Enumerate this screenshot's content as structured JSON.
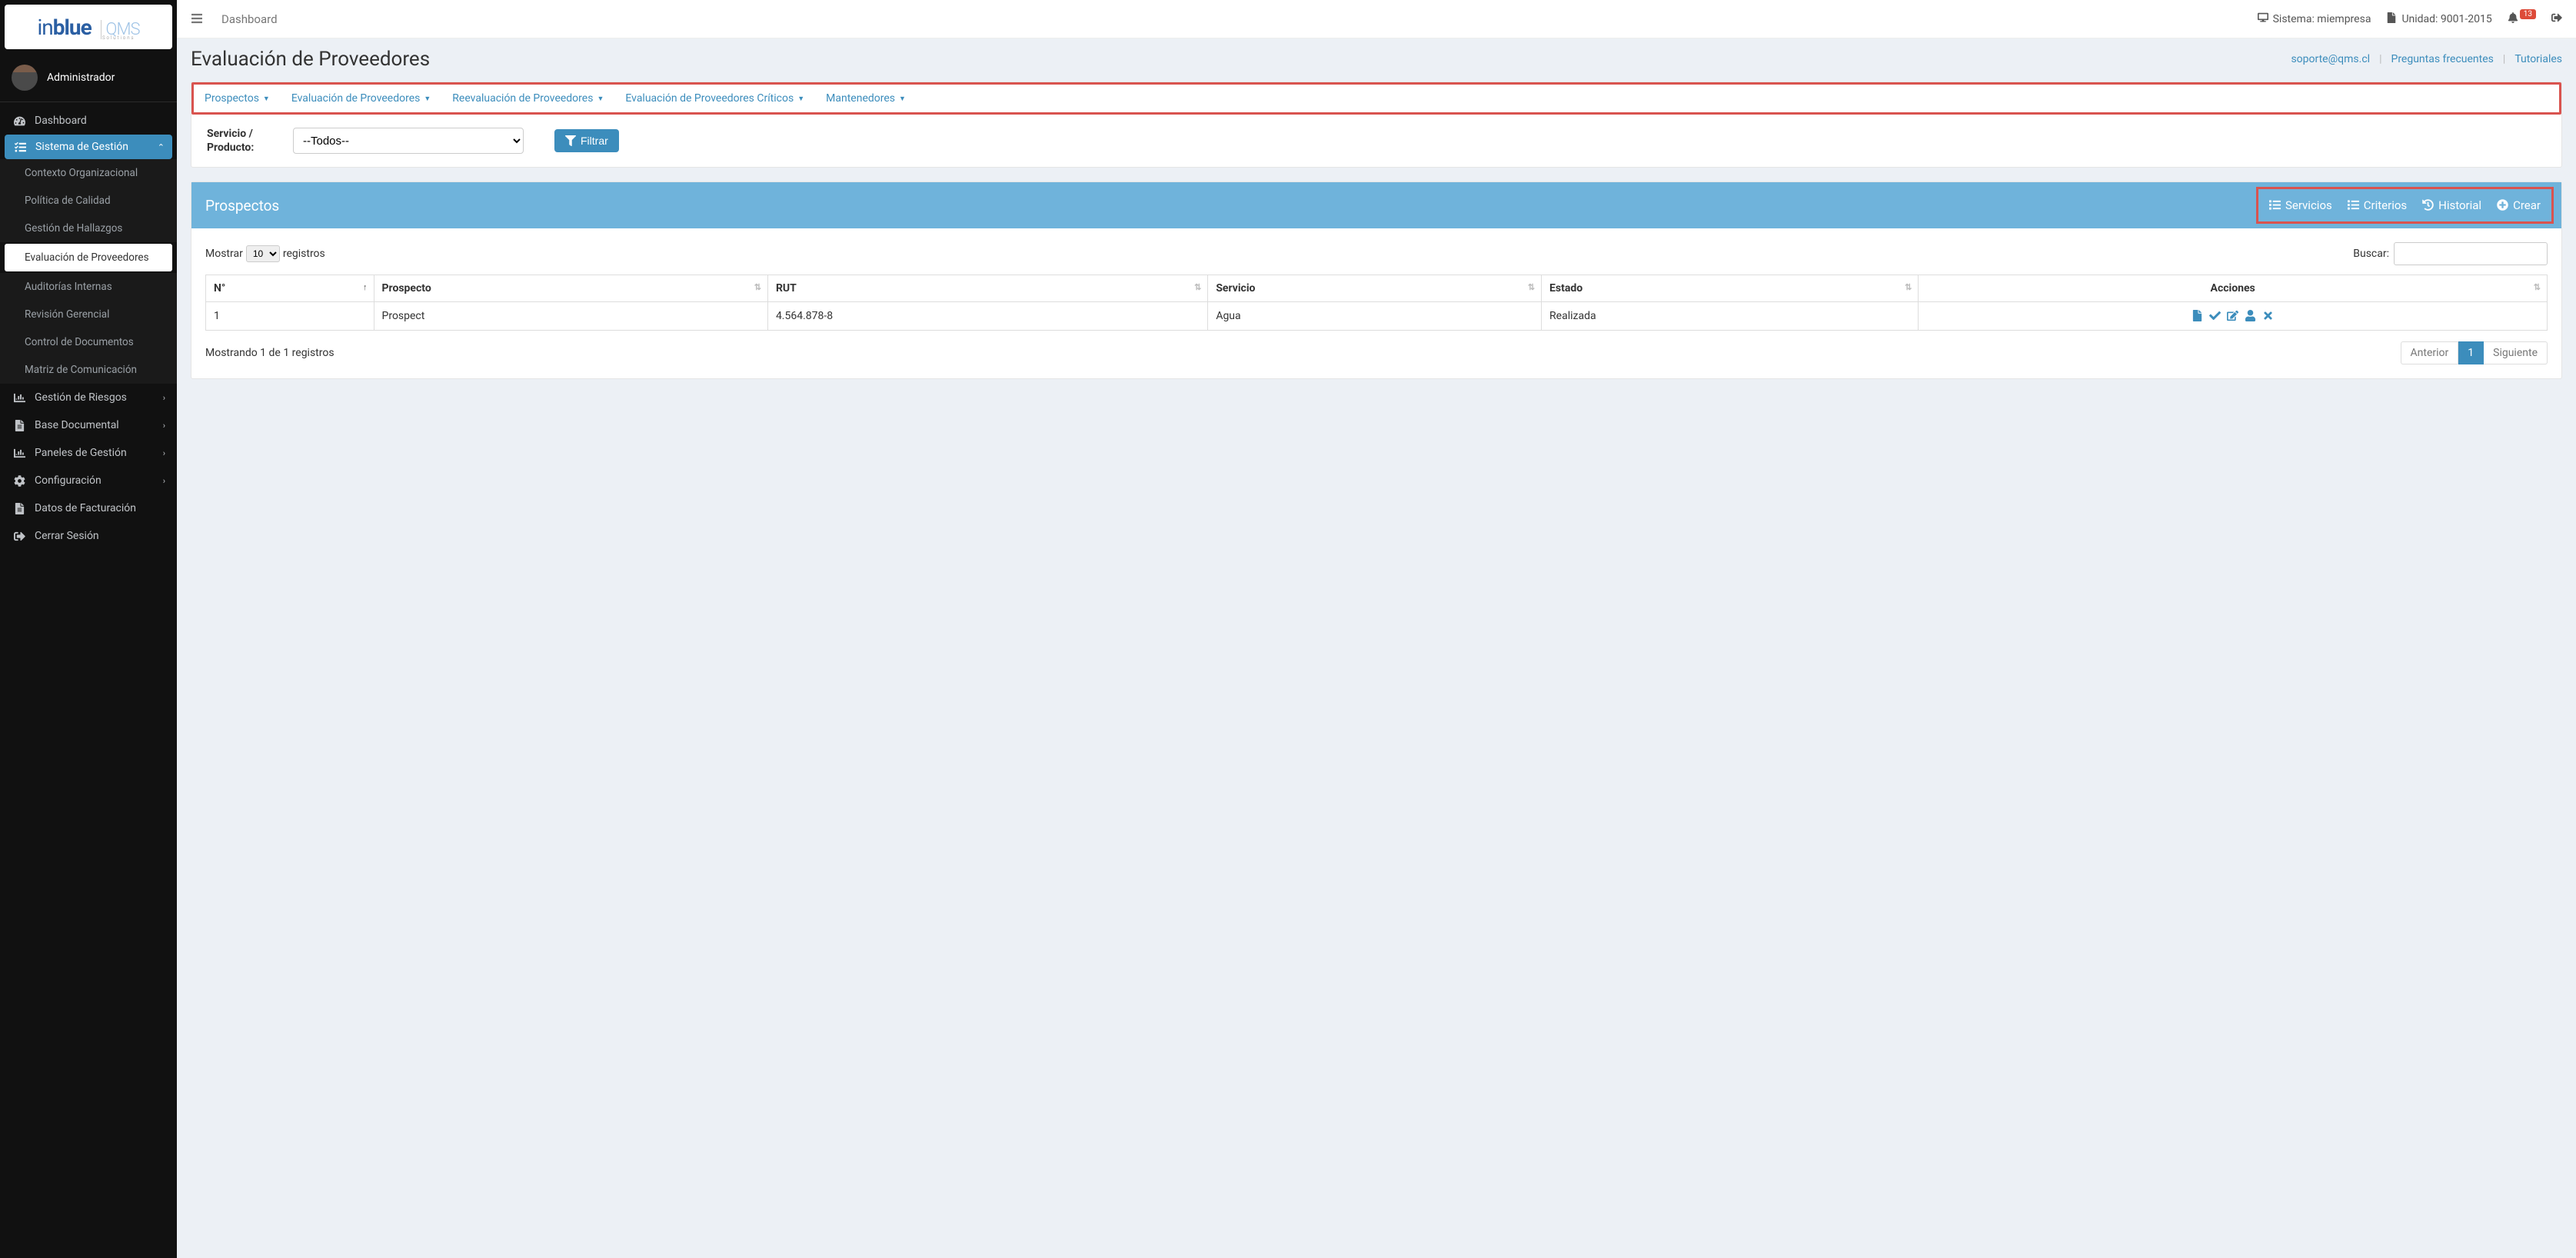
{
  "logo": {
    "brand_in": "in",
    "brand_blue": "blue",
    "brand_qms": "QMS",
    "brand_sub": "Solutions"
  },
  "user": {
    "name": "Administrador"
  },
  "topbar": {
    "breadcrumb": "Dashboard",
    "sistema_label": "Sistema: miempresa",
    "unidad_label": "Unidad: 9001-2015",
    "notif_count": "13"
  },
  "sidebar": {
    "items": [
      {
        "icon": "tachometer",
        "label": "Dashboard"
      },
      {
        "icon": "tasks",
        "label": "Sistema de Gestión",
        "active": true,
        "open": true
      },
      {
        "sub": true,
        "label": "Contexto Organizacional"
      },
      {
        "sub": true,
        "label": "Política de Calidad"
      },
      {
        "sub": true,
        "label": "Gestión de Hallazgos"
      },
      {
        "sub": true,
        "label": "Evaluación de Proveedores",
        "selected": true
      },
      {
        "sub": true,
        "label": "Auditorías Internas"
      },
      {
        "sub": true,
        "label": "Revisión Gerencial"
      },
      {
        "sub": true,
        "label": "Control de Documentos"
      },
      {
        "sub": true,
        "label": "Matriz de Comunicación"
      },
      {
        "icon": "chart-bar",
        "label": "Gestión de Riesgos",
        "caret": true
      },
      {
        "icon": "file",
        "label": "Base Documental",
        "caret": true
      },
      {
        "icon": "chart-bar",
        "label": "Paneles de Gestión",
        "caret": true
      },
      {
        "icon": "gear",
        "label": "Configuración",
        "caret": true
      },
      {
        "icon": "file",
        "label": "Datos de Facturación"
      },
      {
        "icon": "sign-out",
        "label": "Cerrar Sesión"
      }
    ]
  },
  "page": {
    "title": "Evaluación de Proveedores",
    "links": {
      "support": "soporte@qms.cl",
      "faq": "Preguntas frecuentes",
      "tutorials": "Tutoriales"
    }
  },
  "tabs": [
    "Prospectos",
    "Evaluación de Proveedores",
    "Reevaluación de Proveedores",
    "Evaluación de Proveedores Críticos",
    "Mantenedores"
  ],
  "filter": {
    "label": "Servicio / Producto:",
    "selected": "--Todos--",
    "button": "Filtrar"
  },
  "panel": {
    "title": "Prospectos",
    "actions": {
      "servicios": "Servicios",
      "criterios": "Criterios",
      "historial": "Historial",
      "crear": "Crear"
    }
  },
  "table": {
    "show_prefix": "Mostrar",
    "show_suffix": "registros",
    "page_length": "10",
    "search_label": "Buscar:",
    "columns": [
      "N°",
      "Prospecto",
      "RUT",
      "Servicio",
      "Estado",
      "Acciones"
    ],
    "rows": [
      {
        "n": "1",
        "prospecto": "Prospect",
        "rut": "4.564.878-8",
        "servicio": "Agua",
        "estado": "Realizada"
      }
    ],
    "info": "Mostrando 1 de 1 registros",
    "pager": {
      "prev": "Anterior",
      "current": "1",
      "next": "Siguiente"
    }
  }
}
